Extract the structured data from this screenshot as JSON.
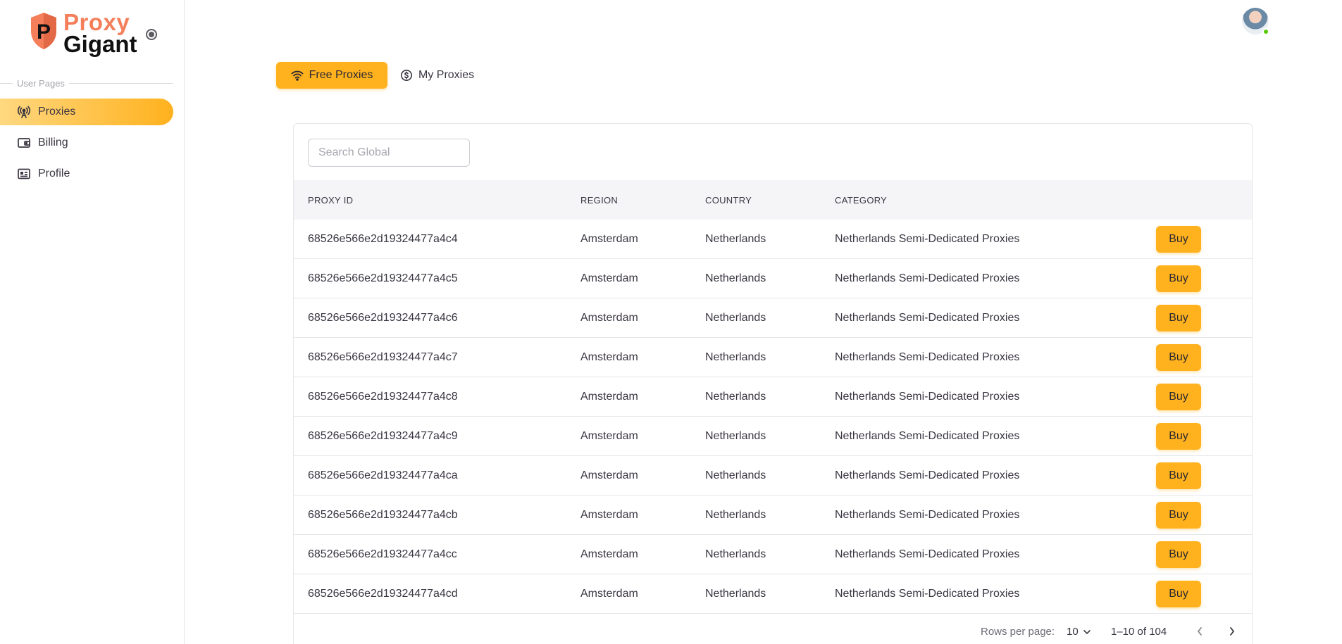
{
  "brand": {
    "line1": "Proxy",
    "line2": "Gigant",
    "shield_letter": "P",
    "colors": {
      "accent": "#ffb11e",
      "logo": "#f47f5a"
    }
  },
  "sidebar": {
    "section_label": "User Pages",
    "items": [
      {
        "label": "Proxies",
        "icon": "antenna-icon",
        "active": true
      },
      {
        "label": "Billing",
        "icon": "wallet-icon",
        "active": false
      },
      {
        "label": "Profile",
        "icon": "id-card-icon",
        "active": false
      }
    ]
  },
  "tabs": {
    "free_label": "Free Proxies",
    "my_label": "My Proxies"
  },
  "search": {
    "placeholder": "Search Global",
    "value": ""
  },
  "table": {
    "headers": [
      "PROXY ID",
      "REGION",
      "COUNTRY",
      "CATEGORY"
    ],
    "buy_label": "Buy",
    "rows": [
      {
        "id": "68526e566e2d19324477a4c4",
        "region": "Amsterdam",
        "country": "Netherlands",
        "category": "Netherlands Semi-Dedicated Proxies"
      },
      {
        "id": "68526e566e2d19324477a4c5",
        "region": "Amsterdam",
        "country": "Netherlands",
        "category": "Netherlands Semi-Dedicated Proxies"
      },
      {
        "id": "68526e566e2d19324477a4c6",
        "region": "Amsterdam",
        "country": "Netherlands",
        "category": "Netherlands Semi-Dedicated Proxies"
      },
      {
        "id": "68526e566e2d19324477a4c7",
        "region": "Amsterdam",
        "country": "Netherlands",
        "category": "Netherlands Semi-Dedicated Proxies"
      },
      {
        "id": "68526e566e2d19324477a4c8",
        "region": "Amsterdam",
        "country": "Netherlands",
        "category": "Netherlands Semi-Dedicated Proxies"
      },
      {
        "id": "68526e566e2d19324477a4c9",
        "region": "Amsterdam",
        "country": "Netherlands",
        "category": "Netherlands Semi-Dedicated Proxies"
      },
      {
        "id": "68526e566e2d19324477a4ca",
        "region": "Amsterdam",
        "country": "Netherlands",
        "category": "Netherlands Semi-Dedicated Proxies"
      },
      {
        "id": "68526e566e2d19324477a4cb",
        "region": "Amsterdam",
        "country": "Netherlands",
        "category": "Netherlands Semi-Dedicated Proxies"
      },
      {
        "id": "68526e566e2d19324477a4cc",
        "region": "Amsterdam",
        "country": "Netherlands",
        "category": "Netherlands Semi-Dedicated Proxies"
      },
      {
        "id": "68526e566e2d19324477a4cd",
        "region": "Amsterdam",
        "country": "Netherlands",
        "category": "Netherlands Semi-Dedicated Proxies"
      }
    ]
  },
  "pagination": {
    "rows_per_page_label": "Rows per page:",
    "rows_per_page_value": "10",
    "range_text": "1–10 of 104"
  }
}
